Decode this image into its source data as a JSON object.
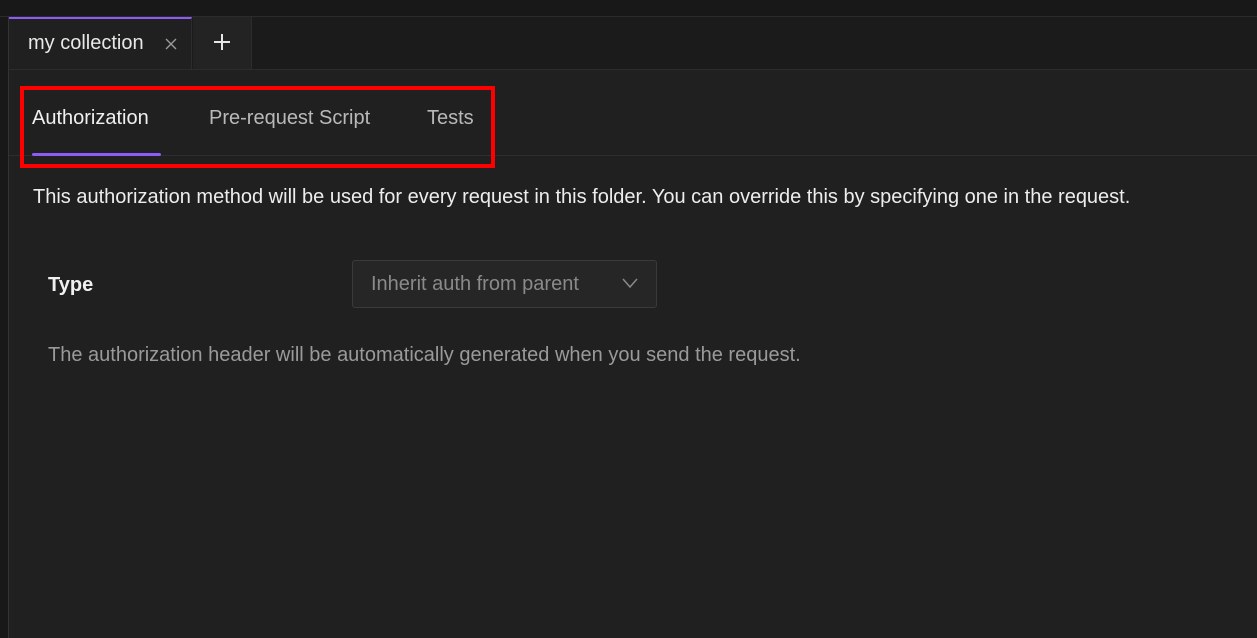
{
  "tabs": {
    "active_tab": "my collection",
    "new_tab_icon": "plus-icon",
    "close_icon": "close-icon"
  },
  "subtabs": {
    "items": [
      "Authorization",
      "Pre-request Script",
      "Tests"
    ],
    "active": "Authorization"
  },
  "content": {
    "info": "This authorization method will be used for every request in this folder. You can override this by specifying one in the request.",
    "type_label": "Type",
    "type_value": "Inherit auth from parent",
    "hint": "The authorization header will be automatically generated when you send the request."
  },
  "colors": {
    "accent": "#8b5cf6",
    "highlight": "#ff0000",
    "background": "#202020"
  }
}
